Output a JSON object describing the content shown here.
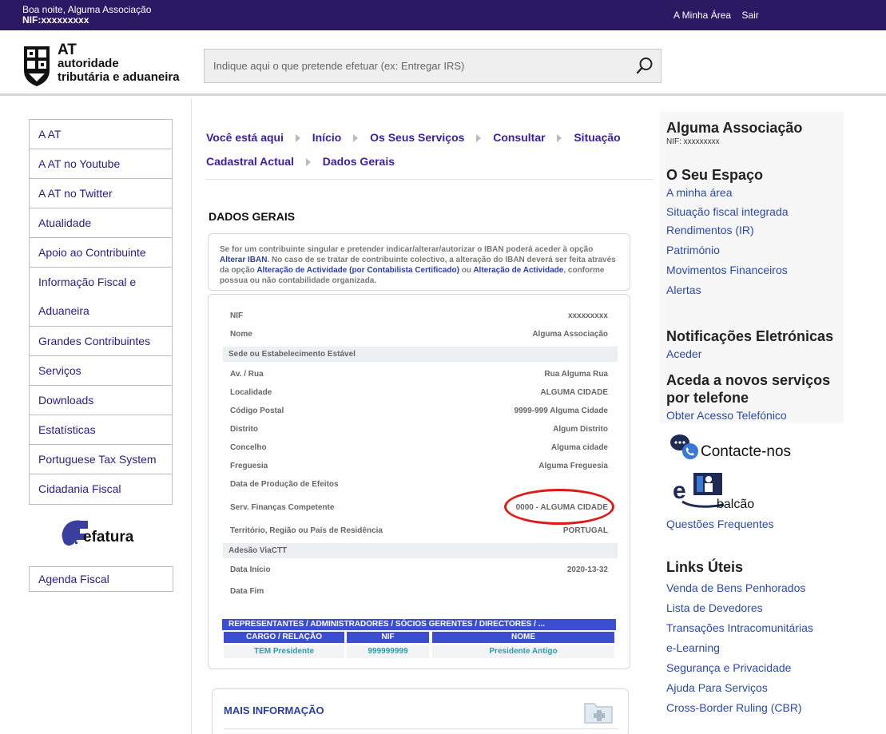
{
  "topbar": {
    "greeting": "Boa noite, Alguma Associação",
    "nif_line": "NIF:xxxxxxxxx",
    "my_area": "A Minha Área",
    "logout": "Sair"
  },
  "header": {
    "logo_line1": "AT",
    "logo_line2": "autoridade",
    "logo_line3": "tributária e aduaneira",
    "search_placeholder": "Indique aqui o que pretende efetuar (ex: Entregar IRS)"
  },
  "left_menu": [
    "A AT",
    "A AT no Youtube",
    "A AT no Twitter",
    "Atualidade",
    "Apoio ao Contribuinte",
    "Informação Fiscal e Aduaneira",
    "Grandes Contribuintes",
    "Serviços",
    "Downloads",
    "Estatísticas",
    "Portuguese Tax System",
    "Cidadania Fiscal"
  ],
  "efatura_label": "efatura",
  "agenda_label": "Agenda Fiscal",
  "breadcrumb": {
    "here": "Você está aqui",
    "items": [
      "Início",
      "Os Seus Serviços",
      "Consultar",
      "Situação Cadastral Actual",
      "Dados Gerais"
    ]
  },
  "section_title": "DADOS GERAIS",
  "notice": {
    "p1": "Se for um contribuinte singular e pretender indicar/alterar/autorizar o IBAN poderá aceder à opção",
    "link1": "Alterar IBAN",
    "p2": ". No caso de se tratar de contribuinte colectivo, a alteração do IBAN deverá ser feita através da opção",
    "link2": "Alteração de Actividade (por Contabilista Certificado)",
    "p3": "ou",
    "link3": "Alteração de Actividade",
    "p4": ", conforme possua ou não contabilidade organizada."
  },
  "details": {
    "nif_label": "NIF",
    "nif_value": "xxxxxxxxx",
    "nome_label": "Nome",
    "nome_value": "Alguma Associação",
    "sede_section": "Sede ou Estabelecimento Estável",
    "rua_label": "Av. / Rua",
    "rua_value": "Rua Alguma Rua",
    "localidade_label": "Localidade",
    "localidade_value": "ALGUMA CIDADE",
    "cp_label": "Código Postal",
    "cp_value": "9999-999 Alguma Cidade",
    "distrito_label": "Distrito",
    "distrito_value": "Algum Distrito",
    "concelho_label": "Concelho",
    "concelho_value": "Alguma cidade",
    "freguesia_label": "Freguesia",
    "freguesia_value": "Alguma Freguesia",
    "data_efeitos_label": "Data de Produção de Efeitos",
    "data_efeitos_value": "",
    "servico_label": "Serv. Finanças Competente",
    "servico_value": "0000 - ALGUMA CIDADE",
    "territorio_label": "Território, Região ou País de Residência",
    "territorio_value": "PORTUGAL",
    "viactt_section": "Adesão ViaCTT",
    "inicio_label": "Data Início",
    "inicio_value": "2020-13-32",
    "fim_label": "Data Fim",
    "fim_value": ""
  },
  "representantes": {
    "title": "REPRESENTANTES / ADMINISTRADORES / SÓCIOS GERENTES / DIRECTORES / ...",
    "col1": "CARGO / RELAÇÃO",
    "col2": "NIF",
    "col3": "NOME",
    "row_cargo": "TEM Presidente",
    "row_nif": "999999999",
    "row_nome": "Presidente Antigo"
  },
  "mais_info": "MAIS INFORMAÇÃO",
  "right": {
    "org_name": "Alguma Associação",
    "org_nif": "NIF: xxxxxxxxx",
    "espaco_title": "O Seu Espaço",
    "espaco_links": [
      "A minha área",
      "Situação fiscal integrada",
      "Rendimentos (IR)",
      "Património",
      "Movimentos Financeiros",
      "Alertas"
    ],
    "notif_title": "Notificações Eletrónicas",
    "notif_link": "Aceder",
    "tel_title_1": "Aceda a novos serviços",
    "tel_title_2": "por telefone",
    "tel_link": "Obter Acesso Telefónico",
    "contacte": "Contacte-nos",
    "ebalcao": "balcão",
    "faq": "Questões Frequentes",
    "links_title": "Links Úteis",
    "links": [
      "Venda de Bens Penhorados",
      "Lista de Devedores",
      "Transações Intracomunitárias",
      "e-Learning",
      "Segurança e Privacidade",
      "Ajuda Para Serviços",
      "Cross-Border Ruling (CBR)"
    ]
  },
  "colors": {
    "topbar": "#2b1a63",
    "link": "#2b4aa8",
    "table_header": "#3c4ed0",
    "highlight_oval": "#e01818"
  }
}
